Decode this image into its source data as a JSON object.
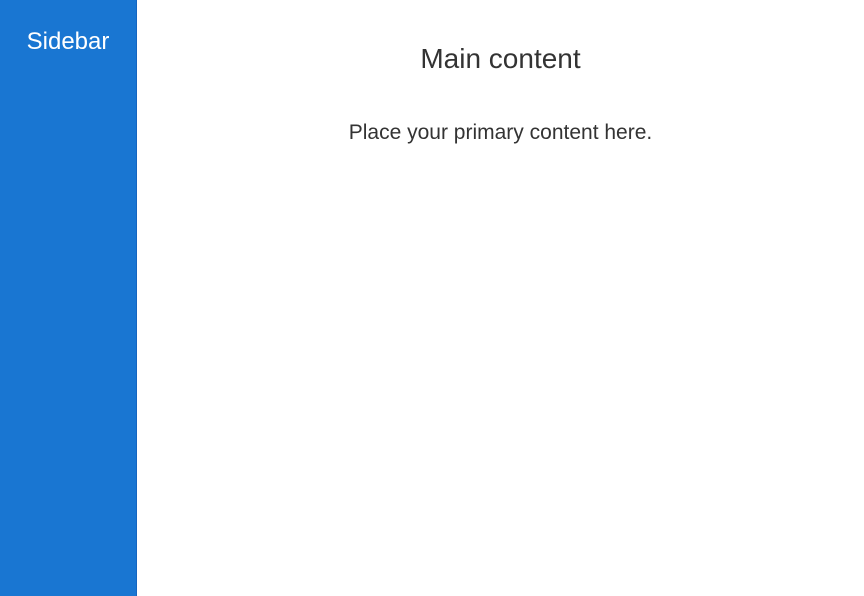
{
  "sidebar": {
    "title": "Sidebar",
    "color": "#1976d2"
  },
  "main": {
    "title": "Main content",
    "body": "Place your primary content here."
  }
}
